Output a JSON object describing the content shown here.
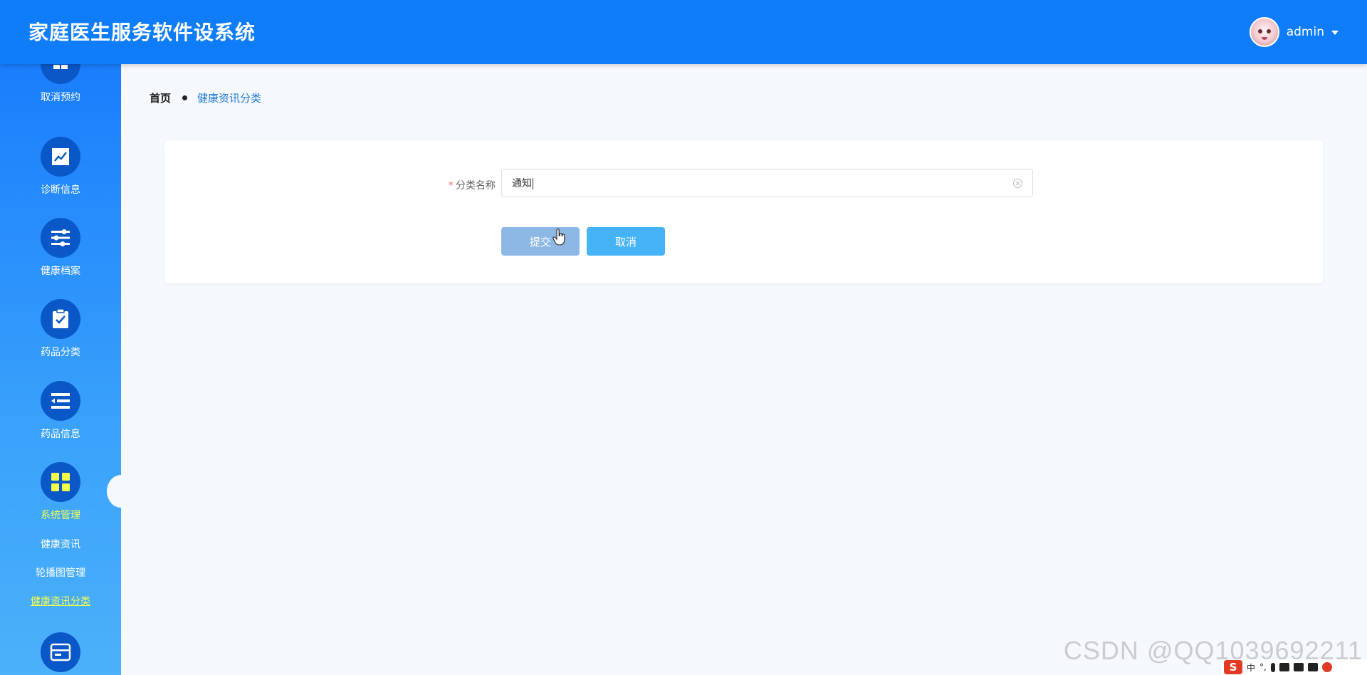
{
  "header": {
    "title": "家庭医生服务软件设系统",
    "username": "admin"
  },
  "sidebar": {
    "items": [
      {
        "label": "取消预约",
        "icon": "calendar-icon"
      },
      {
        "label": "诊断信息",
        "icon": "chart-icon"
      },
      {
        "label": "健康档案",
        "icon": "sliders-icon"
      },
      {
        "label": "药品分类",
        "icon": "clipboard-check-icon"
      },
      {
        "label": "药品信息",
        "icon": "list-icon"
      },
      {
        "label": "系统管理",
        "icon": "grid-icon",
        "active": true
      },
      {
        "label": "",
        "icon": "card-icon"
      }
    ],
    "sub_items": [
      {
        "label": "健康资讯"
      },
      {
        "label": "轮播图管理"
      },
      {
        "label": "健康资讯分类",
        "active": true
      }
    ],
    "active_label_color": "#f5ff4a"
  },
  "breadcrumb": {
    "home": "首页",
    "current": "健康资讯分类"
  },
  "form": {
    "field_label": "分类名称",
    "required_mark": "*",
    "field_value": "通知",
    "submit_label": "提交",
    "cancel_label": "取消"
  },
  "watermark": "CSDN @QQ1039692211",
  "tray": {
    "ime_logo": "S",
    "ime_mode": "中",
    "punct": "°,"
  },
  "colors": {
    "header_bg": "#0f7dfa",
    "submit_bg": "#8db8e6",
    "cancel_bg": "#45b3f5",
    "breadcrumb_current": "#1f7ad6"
  }
}
